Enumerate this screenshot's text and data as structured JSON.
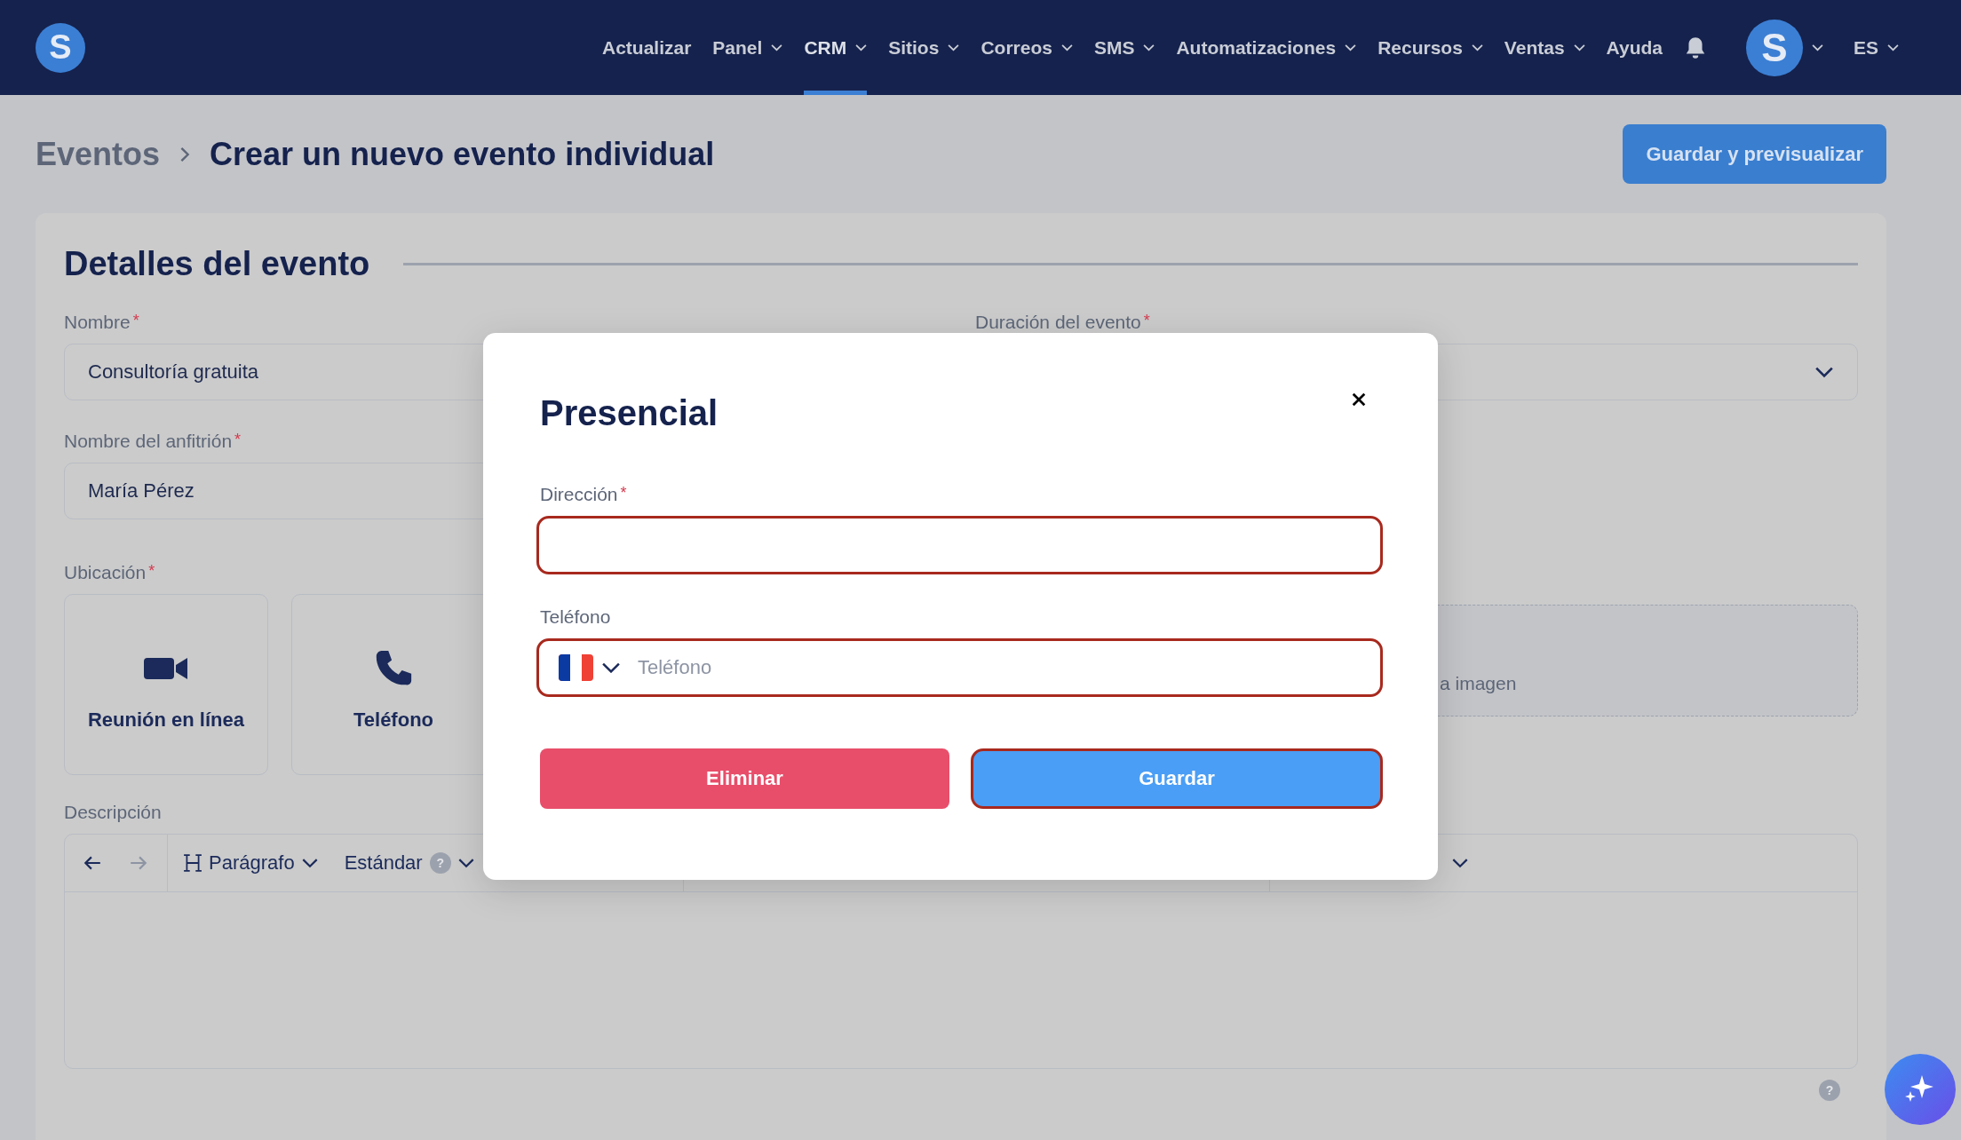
{
  "nav": {
    "logo_letter": "S",
    "items": [
      {
        "label": "Actualizar",
        "dropdown": false,
        "selected": false
      },
      {
        "label": "Panel",
        "dropdown": true,
        "selected": false
      },
      {
        "label": "CRM",
        "dropdown": true,
        "selected": true
      },
      {
        "label": "Sitios",
        "dropdown": true,
        "selected": false
      },
      {
        "label": "Correos",
        "dropdown": true,
        "selected": false
      },
      {
        "label": "SMS",
        "dropdown": true,
        "selected": false
      },
      {
        "label": "Automatizaciones",
        "dropdown": true,
        "selected": false
      },
      {
        "label": "Recursos",
        "dropdown": true,
        "selected": false
      },
      {
        "label": "Ventas",
        "dropdown": true,
        "selected": false
      },
      {
        "label": "Ayuda",
        "dropdown": false,
        "selected": false
      }
    ],
    "avatar_initial": "S",
    "language": "ES"
  },
  "header": {
    "breadcrumb": [
      "Eventos",
      "Crear un nuevo evento individual"
    ],
    "button": "Guardar y previsualizar"
  },
  "card": {
    "title": "Detalles del evento",
    "name": {
      "label": "Nombre",
      "required_mark": "*",
      "value": "Consultoría gratuita"
    },
    "duration": {
      "label": "Duración del evento",
      "required_mark": "*"
    },
    "host": {
      "label": "Nombre del anfitrión",
      "required_mark": "*",
      "value": "María Pérez"
    },
    "location": {
      "label": "Ubicación",
      "required_mark": "*",
      "options": [
        {
          "label": "Reunión en línea",
          "kind": "video"
        },
        {
          "label": "Teléfono",
          "kind": "phone"
        }
      ]
    },
    "image_upload": {
      "text": "a imagen"
    },
    "description": {
      "label": "Descripción",
      "block_style": "Parágrafo",
      "font": "Estándar",
      "help_glyph": "?"
    },
    "help_glyph": "?"
  },
  "modal": {
    "title": "Presencial",
    "fields": [
      {
        "label": "Dirección",
        "required_mark": "*",
        "kind": "text",
        "invalid": true
      },
      {
        "label": "Teléfono",
        "kind": "phone",
        "placeholder": "Teléfono",
        "invalid": true
      }
    ],
    "buttons": [
      {
        "label": "Eliminar",
        "kind": "danger",
        "focused": false
      },
      {
        "label": "Guardar",
        "kind": "primary",
        "focused": true
      }
    ]
  }
}
